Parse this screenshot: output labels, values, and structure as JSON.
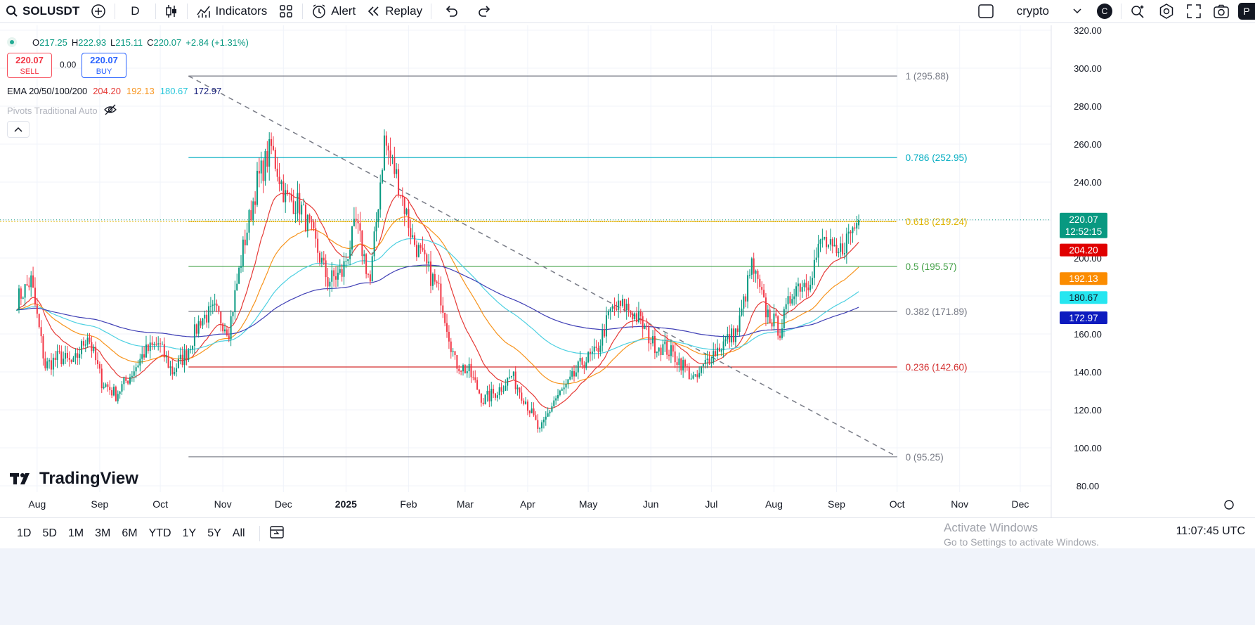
{
  "toolbar": {
    "symbol": "SOLUSDT",
    "interval": "D",
    "indicators_label": "Indicators",
    "alert_label": "Alert",
    "replay_label": "Replay",
    "layout_name": "crypto",
    "avatar_letter": "C",
    "publish_letter": "P"
  },
  "legend": {
    "ohlc": [
      {
        "key": "O",
        "value": "217.25"
      },
      {
        "key": "H",
        "value": "222.93"
      },
      {
        "key": "L",
        "value": "215.11"
      },
      {
        "key": "C",
        "value": "220.07"
      }
    ],
    "change": "+2.84 (+1.31%)",
    "sell_price": "220.07",
    "sell_label": "SELL",
    "spread": "0.00",
    "buy_price": "220.07",
    "buy_label": "BUY",
    "ema_name": "EMA 20/50/100/200",
    "ema_values": [
      "204.20",
      "192.13",
      "180.67",
      "172.97"
    ],
    "pivots_label": "Pivots Traditional Auto"
  },
  "colors": {
    "up": "#089981",
    "down": "#f23645",
    "ema20": "#e53935",
    "ema50": "#f7941d",
    "ema100": "#4dd0e1",
    "ema200": "#3f3fb5",
    "fib_1": "#787b86",
    "fib_786": "#00acc1",
    "fib_618": "#e0b400",
    "fib_5": "#43a047",
    "fib_382": "#787b86",
    "fib_236": "#d32f2f",
    "fib_0": "#787b86"
  },
  "chart_data": {
    "type": "candlestick",
    "symbol": "SOLUSDT",
    "interval": "D",
    "y_ticks": [
      "320.00",
      "300.00",
      "280.00",
      "260.00",
      "240.00",
      "220.00",
      "200.00",
      "180.00",
      "160.00",
      "140.00",
      "120.00",
      "100.00",
      "80.00"
    ],
    "x_ticks": [
      "Aug",
      "Sep",
      "Oct",
      "Nov",
      "Dec",
      "2025",
      "Feb",
      "Mar",
      "Apr",
      "May",
      "Jun",
      "Jul",
      "Aug",
      "Sep",
      "Oct",
      "Nov",
      "Dec"
    ],
    "ylim": [
      77,
      323
    ],
    "fib_levels": [
      {
        "ratio": "1",
        "price": 295.88,
        "label": "1 (295.88)"
      },
      {
        "ratio": "0.786",
        "price": 252.95,
        "label": "0.786 (252.95)"
      },
      {
        "ratio": "0.618",
        "price": 219.24,
        "label": "0.618 (219.24)"
      },
      {
        "ratio": "0.5",
        "price": 195.57,
        "label": "0.5 (195.57)"
      },
      {
        "ratio": "0.382",
        "price": 171.89,
        "label": "0.382 (171.89)"
      },
      {
        "ratio": "0.236",
        "price": 142.6,
        "label": "0.236 (142.60)"
      },
      {
        "ratio": "0",
        "price": 95.25,
        "label": "0 (95.25)"
      }
    ],
    "trendline": {
      "from_date": "2024-10-15",
      "from_price": 295.9,
      "to_date": "2025-10-01",
      "to_price": 95.3
    },
    "price_tags": [
      {
        "value": "220.07",
        "price": 220.07,
        "extra": "12:52:15",
        "kind": "last"
      },
      {
        "value": "204.20",
        "price": 204.2,
        "kind": "ema20"
      },
      {
        "value": "192.13",
        "price": 192.13,
        "kind": "ema50"
      },
      {
        "value": "180.67",
        "price": 180.67,
        "kind": "ema100"
      },
      {
        "value": "172.97",
        "price": 172.97,
        "kind": "ema200"
      }
    ],
    "price_anchors": [
      [
        "2024-07-22",
        178
      ],
      [
        "2024-07-29",
        188
      ],
      [
        "2024-08-05",
        143
      ],
      [
        "2024-08-12",
        148
      ],
      [
        "2024-08-19",
        144
      ],
      [
        "2024-08-26",
        160
      ],
      [
        "2024-09-02",
        135
      ],
      [
        "2024-09-09",
        128
      ],
      [
        "2024-09-16",
        138
      ],
      [
        "2024-09-23",
        150
      ],
      [
        "2024-09-30",
        155
      ],
      [
        "2024-10-07",
        140
      ],
      [
        "2024-10-14",
        150
      ],
      [
        "2024-10-21",
        168
      ],
      [
        "2024-10-28",
        172
      ],
      [
        "2024-11-04",
        162
      ],
      [
        "2024-11-11",
        205
      ],
      [
        "2024-11-18",
        240
      ],
      [
        "2024-11-25",
        258
      ],
      [
        "2024-12-02",
        232
      ],
      [
        "2024-12-09",
        228
      ],
      [
        "2024-12-16",
        210
      ],
      [
        "2024-12-23",
        188
      ],
      [
        "2024-12-30",
        192
      ],
      [
        "2025-01-06",
        218
      ],
      [
        "2025-01-13",
        187
      ],
      [
        "2025-01-20",
        262
      ],
      [
        "2025-01-27",
        240
      ],
      [
        "2025-02-03",
        210
      ],
      [
        "2025-02-10",
        195
      ],
      [
        "2025-02-17",
        180
      ],
      [
        "2025-02-24",
        145
      ],
      [
        "2025-03-03",
        140
      ],
      [
        "2025-03-10",
        125
      ],
      [
        "2025-03-17",
        130
      ],
      [
        "2025-03-24",
        138
      ],
      [
        "2025-03-31",
        125
      ],
      [
        "2025-04-07",
        108
      ],
      [
        "2025-04-14",
        125
      ],
      [
        "2025-04-21",
        133
      ],
      [
        "2025-04-28",
        145
      ],
      [
        "2025-05-05",
        150
      ],
      [
        "2025-05-12",
        172
      ],
      [
        "2025-05-19",
        175
      ],
      [
        "2025-05-26",
        168
      ],
      [
        "2025-06-02",
        155
      ],
      [
        "2025-06-09",
        152
      ],
      [
        "2025-06-16",
        145
      ],
      [
        "2025-06-23",
        135
      ],
      [
        "2025-06-30",
        148
      ],
      [
        "2025-07-07",
        155
      ],
      [
        "2025-07-14",
        162
      ],
      [
        "2025-07-21",
        196
      ],
      [
        "2025-07-28",
        172
      ],
      [
        "2025-08-04",
        162
      ],
      [
        "2025-08-11",
        185
      ],
      [
        "2025-08-18",
        188
      ],
      [
        "2025-08-25",
        210
      ],
      [
        "2025-09-01",
        200
      ],
      [
        "2025-09-08",
        214
      ],
      [
        "2025-09-12",
        220.07
      ]
    ],
    "last_bar": {
      "open": 217.25,
      "high": 222.93,
      "low": 215.11,
      "close": 220.07
    }
  },
  "footer": {
    "ranges": [
      "1D",
      "5D",
      "1M",
      "3M",
      "6M",
      "YTD",
      "1Y",
      "5Y",
      "All"
    ],
    "time": "11:07:45 UTC",
    "watermark_title": "Activate Windows",
    "watermark_sub": "Go to Settings to activate Windows.",
    "brand": "TradingView"
  }
}
